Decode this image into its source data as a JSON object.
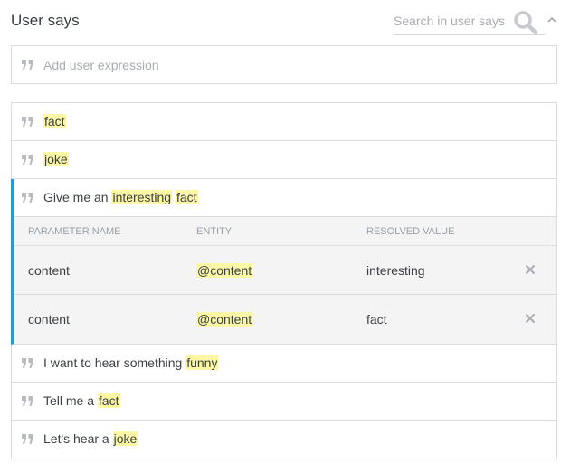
{
  "header": {
    "title": "User says",
    "search_placeholder": "Search in user says",
    "icons": {
      "search": "search-icon",
      "collapse": "chevron-up-icon"
    }
  },
  "add_expression": {
    "placeholder": "Add user expression",
    "icon": "quote-icon"
  },
  "expressions_before": [
    {
      "segments": [
        {
          "text": "fact",
          "highlight": true
        }
      ]
    },
    {
      "segments": [
        {
          "text": "joke",
          "highlight": true
        }
      ]
    }
  ],
  "expanded_expression": {
    "segments": [
      {
        "text": "Give me an ",
        "highlight": false
      },
      {
        "text": "interesting",
        "highlight": true
      },
      {
        "text": " ",
        "highlight": false
      },
      {
        "text": "fact",
        "highlight": true
      }
    ],
    "table": {
      "headers": [
        "PARAMETER NAME",
        "ENTITY",
        "RESOLVED VALUE"
      ],
      "rows": [
        {
          "parameter": "content",
          "entity": "@content",
          "value": "interesting"
        },
        {
          "parameter": "content",
          "entity": "@content",
          "value": "fact"
        }
      ]
    }
  },
  "expressions_after": [
    {
      "segments": [
        {
          "text": "I want to hear something ",
          "highlight": false
        },
        {
          "text": "funny",
          "highlight": true
        }
      ]
    },
    {
      "segments": [
        {
          "text": "Tell me a ",
          "highlight": false
        },
        {
          "text": "fact",
          "highlight": true
        }
      ]
    },
    {
      "segments": [
        {
          "text": "Let's hear a ",
          "highlight": false
        },
        {
          "text": "joke",
          "highlight": true
        }
      ]
    }
  ],
  "colors": {
    "highlight": "#fcf7a5",
    "accent": "#2a97d9",
    "border": "#dcdcdc",
    "text": "#3b3f45",
    "muted": "#a9adb2"
  }
}
